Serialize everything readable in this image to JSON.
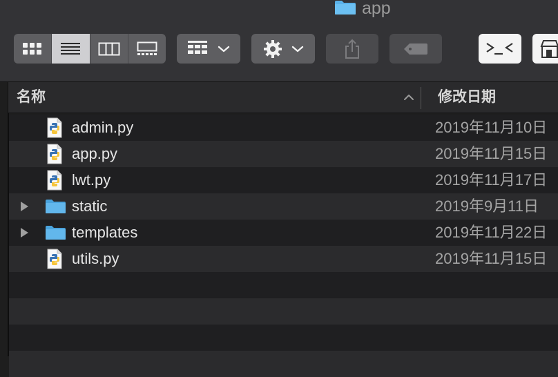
{
  "window": {
    "title": "app"
  },
  "toolbar": {
    "view_modes": [
      "icon-view",
      "list-view",
      "column-view",
      "gallery-view"
    ],
    "active_view": "list-view",
    "group_button": "group-by",
    "action_button": "action-gear",
    "share_button": "share",
    "tags_button": "edit-tags",
    "terminal_button": "open-terminal",
    "extra_button": "more"
  },
  "columns": {
    "name": "名称",
    "date_modified": "修改日期"
  },
  "files": [
    {
      "name": "admin.py",
      "kind": "python-file",
      "date": "2019年11月10日",
      "expandable": false
    },
    {
      "name": "app.py",
      "kind": "python-file",
      "date": "2019年11月15日",
      "expandable": false
    },
    {
      "name": "lwt.py",
      "kind": "python-file",
      "date": "2019年11月17日",
      "expandable": false
    },
    {
      "name": "static",
      "kind": "folder",
      "date": "2019年9月11日",
      "expandable": true
    },
    {
      "name": "templates",
      "kind": "folder",
      "date": "2019年11月22日",
      "expandable": true
    },
    {
      "name": "utils.py",
      "kind": "python-file",
      "date": "2019年11月15日",
      "expandable": false
    }
  ],
  "colors": {
    "toolbar_bg": "#333336",
    "button_bg": "#5e5e61",
    "row_odd": "#2b2b2d",
    "row_even": "#1f1f21",
    "folder_blue": "#5ab1e8"
  }
}
